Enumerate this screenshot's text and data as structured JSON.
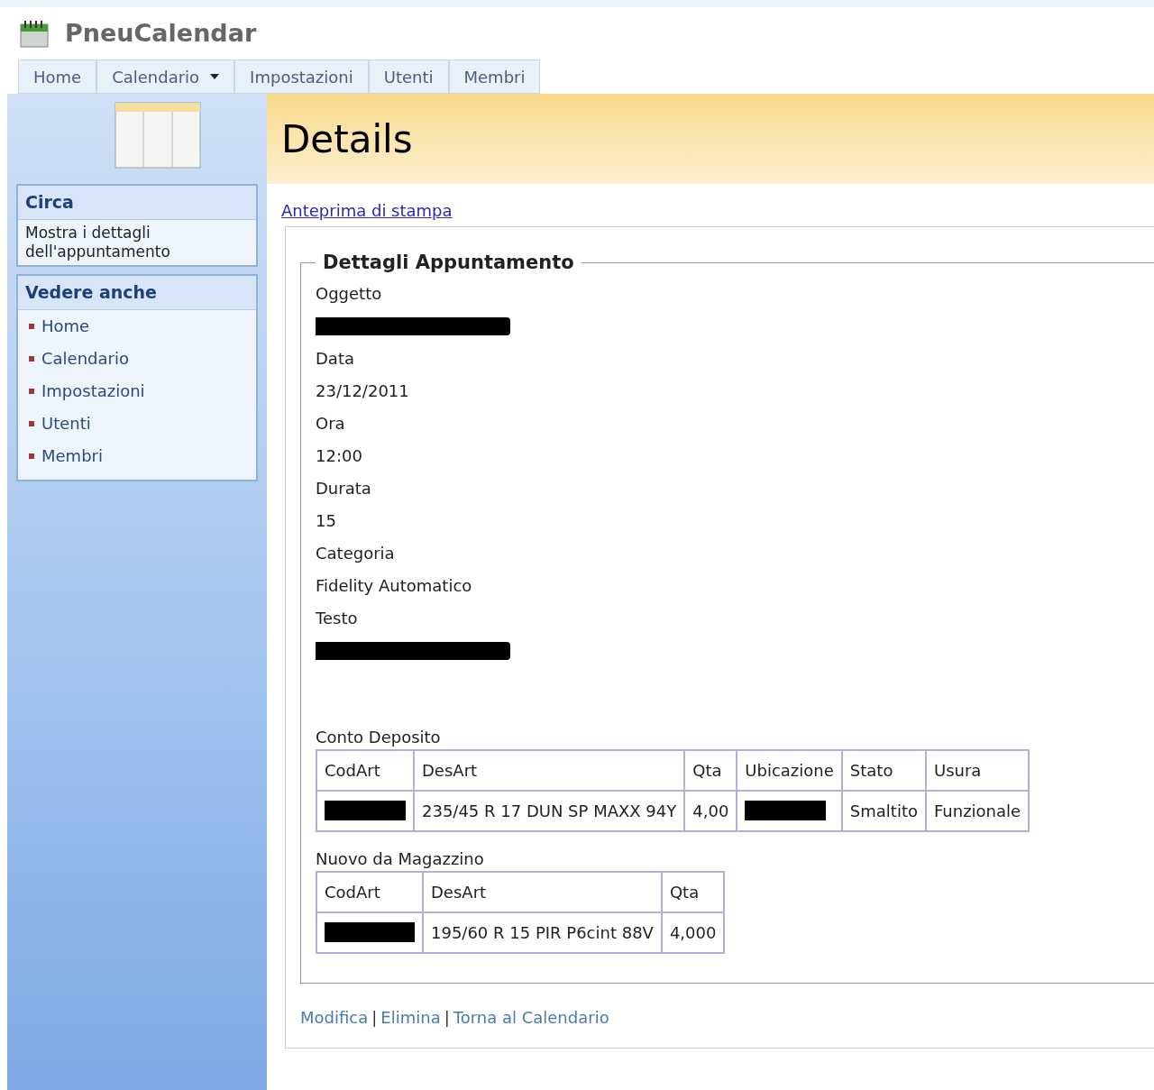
{
  "app": {
    "title": "PneuCalendar"
  },
  "nav": [
    {
      "label": "Home",
      "dropdown": false
    },
    {
      "label": "Calendario",
      "dropdown": true
    },
    {
      "label": "Impostazioni",
      "dropdown": false
    },
    {
      "label": "Utenti",
      "dropdown": false
    },
    {
      "label": "Membri",
      "dropdown": false
    }
  ],
  "sidebar": {
    "about": {
      "title": "Circa",
      "text": "Mostra i dettagli dell'appuntamento"
    },
    "see_also": {
      "title": "Vedere anche",
      "items": [
        "Home",
        "Calendario",
        "Impostazioni",
        "Utenti",
        "Membri"
      ]
    }
  },
  "page": {
    "title": "Details",
    "print_link": "Anteprima di stampa"
  },
  "details": {
    "legend": "Dettagli Appuntamento",
    "fields": [
      {
        "label": "Oggetto",
        "kind": "redacted"
      },
      {
        "label": "Data",
        "kind": "text",
        "value": "23/12/2011"
      },
      {
        "label": "Ora",
        "kind": "text",
        "value": "12:00"
      },
      {
        "label": "Durata",
        "kind": "text",
        "value": "15"
      },
      {
        "label": "Categoria",
        "kind": "text",
        "value": "Fidelity Automatico"
      },
      {
        "label": "Testo",
        "kind": "redacted"
      }
    ],
    "tables": [
      {
        "title": "Conto Deposito",
        "columns": [
          "CodArt",
          "DesArt",
          "Qta",
          "Ubicazione",
          "Stato",
          "Usura"
        ],
        "rows": [
          [
            {
              "kind": "redacted"
            },
            {
              "kind": "text",
              "text": "235/45 R 17 DUN SP MAXX 94Y"
            },
            {
              "kind": "text",
              "text": "4,00"
            },
            {
              "kind": "redacted"
            },
            {
              "kind": "text",
              "text": "Smaltito"
            },
            {
              "kind": "text",
              "text": "Funzionale"
            }
          ]
        ]
      },
      {
        "title": "Nuovo da Magazzino",
        "columns": [
          "CodArt",
          "DesArt",
          "Qta"
        ],
        "rows": [
          [
            {
              "kind": "redacted"
            },
            {
              "kind": "text",
              "text": "195/60 R 15 PIR P6cint 88V"
            },
            {
              "kind": "text",
              "text": "4,000"
            }
          ]
        ]
      }
    ]
  },
  "actions": {
    "separator": "|",
    "links": [
      "Modifica",
      "Elimina",
      "Torna al Calendario"
    ]
  }
}
